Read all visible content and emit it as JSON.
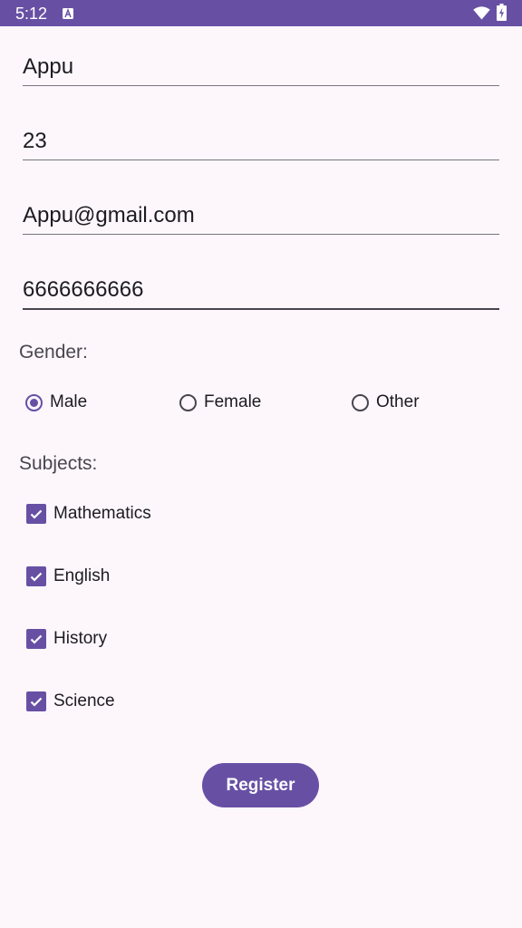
{
  "status_bar": {
    "time": "5:12",
    "icons": [
      "accessibility-a-icon",
      "wifi-icon",
      "battery-charging-icon"
    ]
  },
  "form": {
    "name_value": "Appu",
    "age_value": "23",
    "email_value": "Appu@gmail.com",
    "phone_value": "6666666666"
  },
  "gender": {
    "label": "Gender:",
    "options": [
      {
        "label": "Male",
        "selected": true
      },
      {
        "label": "Female",
        "selected": false
      },
      {
        "label": "Other",
        "selected": false
      }
    ]
  },
  "subjects": {
    "label": "Subjects:",
    "items": [
      {
        "label": "Mathematics",
        "checked": true
      },
      {
        "label": "English",
        "checked": true
      },
      {
        "label": "History",
        "checked": true
      },
      {
        "label": "Science",
        "checked": true
      }
    ]
  },
  "register_button": {
    "label": "Register"
  },
  "colors": {
    "primary": "#6750a4",
    "background": "#fdf7fc",
    "text": "#1d1b20",
    "secondary_text": "#49454f"
  }
}
